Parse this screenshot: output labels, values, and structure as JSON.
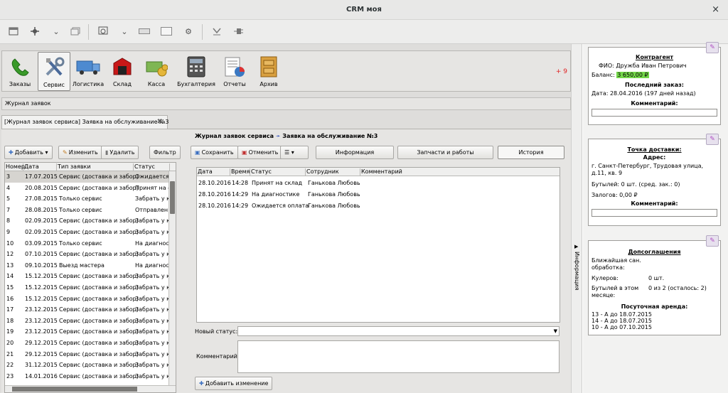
{
  "window": {
    "title": "CRM моя",
    "close": "×"
  },
  "modules": [
    {
      "label": "Заказы",
      "icon": "phone-icon",
      "active": false
    },
    {
      "label": "Сервис",
      "icon": "tools-icon",
      "active": true
    },
    {
      "label": "Логистика",
      "icon": "truck-icon",
      "active": false
    },
    {
      "label": "Склад",
      "icon": "warehouse-icon",
      "active": false
    },
    {
      "label": "Касса",
      "icon": "money-icon",
      "active": false
    },
    {
      "label": "Бухгалтерия",
      "icon": "calculator-icon",
      "active": false
    },
    {
      "label": "Отчеты",
      "icon": "report-icon",
      "active": false
    },
    {
      "label": "Архив",
      "icon": "archive-icon",
      "active": false
    }
  ],
  "notifications_badge": "+ 9",
  "journal_label": "Журнал заявок",
  "tab": {
    "label": "[Журнал заявок сервиса] Заявка на обслуживание №3"
  },
  "left_toolbar": {
    "add": "Добавить",
    "edit": "Изменить",
    "delete": "Удалить",
    "filter": "Фильтр"
  },
  "orders_table": {
    "columns": [
      "Номер",
      "Дата",
      "Тип заявки",
      "Статус"
    ],
    "rows": [
      [
        "3",
        "17.07.2015",
        "Сервис (доставка и забор)",
        "Ожидается"
      ],
      [
        "4",
        "20.08.2015",
        "Сервис (доставка и забор)",
        "Принят на с"
      ],
      [
        "5",
        "27.08.2015",
        "Только сервис",
        "Забрать у к"
      ],
      [
        "7",
        "28.08.2015",
        "Только сервис",
        "Отправлен"
      ],
      [
        "8",
        "02.09.2015",
        "Сервис (доставка и забор)",
        "Забрать у к"
      ],
      [
        "9",
        "02.09.2015",
        "Сервис (доставка и забор)",
        "Забрать у к"
      ],
      [
        "10",
        "03.09.2015",
        "Только сервис",
        "На диагност"
      ],
      [
        "12",
        "07.10.2015",
        "Сервис (доставка и забор)",
        "Забрать у к"
      ],
      [
        "13",
        "09.10.2015",
        "Выезд мастера",
        "На диагност"
      ],
      [
        "14",
        "15.12.2015",
        "Сервис (доставка и забор)",
        "Забрать у к"
      ],
      [
        "15",
        "15.12.2015",
        "Сервис (доставка и забор)",
        "Забрать у к"
      ],
      [
        "16",
        "15.12.2015",
        "Сервис (доставка и забор)",
        "Забрать у к"
      ],
      [
        "17",
        "23.12.2015",
        "Сервис (доставка и забор)",
        "Забрать у к"
      ],
      [
        "18",
        "23.12.2015",
        "Сервис (доставка и забор)",
        "Забрать у к"
      ],
      [
        "19",
        "23.12.2015",
        "Сервис (доставка и забор)",
        "Забрать у к"
      ],
      [
        "20",
        "29.12.2015",
        "Сервис (доставка и забор)",
        "Забрать у к"
      ],
      [
        "21",
        "29.12.2015",
        "Сервис (доставка и забор)",
        "Забрать у к"
      ],
      [
        "22",
        "31.12.2015",
        "Сервис (доставка и забор)",
        "Забрать у к"
      ],
      [
        "23",
        "14.01.2016",
        "Сервис (доставка и забор)",
        "Забрать у к"
      ]
    ]
  },
  "breadcrumb": {
    "parent": "Журнал заявок сервиса",
    "arrow": "➛",
    "current": "Заявка на обслуживание №3"
  },
  "right_toolbar": {
    "save": "Сохранить",
    "cancel": "Отменить",
    "info_tab": "Информация",
    "parts_tab": "Запчасти и работы",
    "history_tab": "История"
  },
  "history_table": {
    "columns": [
      "Дата",
      "Время",
      "Статус",
      "Сотрудник",
      "Комментарий"
    ],
    "rows": [
      [
        "28.10.2016",
        "14:28",
        "Принят на склад",
        "Ганькова Любовь",
        ""
      ],
      [
        "28.10.2016",
        "14:29",
        "На диагностике",
        "Ганькова Любовь",
        ""
      ],
      [
        "28.10.2016",
        "14:29",
        "Ожидается оплата",
        "Ганькова Любовь",
        ""
      ]
    ]
  },
  "form": {
    "new_status_label": "Новый статус:",
    "comment_label": "Комментарий:",
    "add_change": "Добавить изменение"
  },
  "side_toggle": "Информация",
  "contractor": {
    "title": "Контрагент",
    "fio_label": "ФИО:",
    "fio": "Дружба Иван Петрович",
    "balance_label": "Баланс:",
    "balance": "3 650,00 ₽",
    "last_order": "Последний заказ:",
    "date_label": "Дата:",
    "date": "28.04.2016 (197 дней назад)",
    "comment": "Комментарий:"
  },
  "delivery": {
    "title": "Точка доставки:",
    "address_label": "Адрес:",
    "address": "г. Санкт-Петербург, Трудовая улица, д.11, кв. 9",
    "bottles": "Бутылей: 0 шт. (сред. зак.: 0)",
    "deposits": "Залогов: 0,00 ₽",
    "comment": "Комментарий:"
  },
  "agreements": {
    "title": "Допсоглашения",
    "sanitize": "Ближайшая сан. обработка:",
    "coolers_label": "Кулеров:",
    "coolers": "0 шт.",
    "bottles_month_label": "Бутылей в этом месяце:",
    "bottles_month": "0 из 2 (осталось: 2)",
    "rent_title": "Посуточная аренда:",
    "rent": [
      "13 - А до 18.07.2015",
      "14 - А до 18.07.2015",
      "10 - А до 07.10.2015"
    ]
  }
}
